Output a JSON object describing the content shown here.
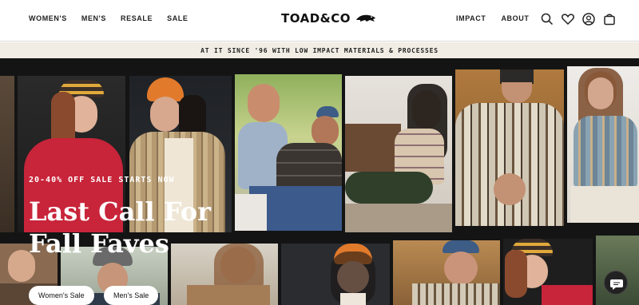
{
  "header": {
    "nav_left": [
      "WOMEN'S",
      "MEN'S",
      "RESALE",
      "SALE"
    ],
    "logo": "TOAD&CO",
    "nav_right": [
      "IMPACT",
      "ABOUT"
    ],
    "icons": [
      "search-icon",
      "heart-icon",
      "account-icon",
      "cart-icon"
    ]
  },
  "announcement": "AT IT SINCE '96 WITH LOW IMPACT MATERIALS & PROCESSES",
  "hero": {
    "promo": "20-40% OFF SALE STARTS NOW",
    "headline": "Last Call For Fall Faves",
    "buttons": [
      "Women's Sale",
      "Men's Sale"
    ]
  },
  "colors": {
    "accent": "#111111",
    "announce_bg": "#f1ece4",
    "hero_bg": "#141414"
  }
}
